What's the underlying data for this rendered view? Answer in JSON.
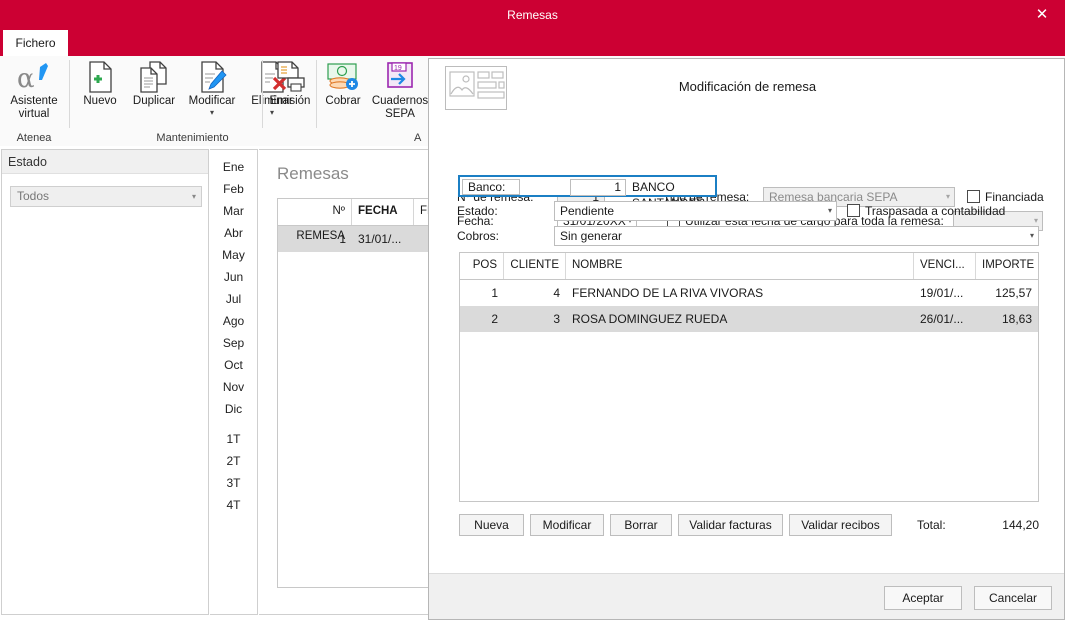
{
  "window": {
    "title": "Remesas",
    "close_label": "✕",
    "accent_color": "#CC0033"
  },
  "ribbon": {
    "tab": "Fichero",
    "groups": [
      {
        "label": "Atenea"
      },
      {
        "label": "Mantenimiento"
      },
      {
        "label": "A"
      }
    ],
    "buttons": {
      "asistente": "Asistente\nvirtual",
      "asistente_line1": "Asistente",
      "asistente_line2": "virtual",
      "nuevo": "Nuevo",
      "duplicar": "Duplicar",
      "modificar": "Modificar",
      "eliminar": "Eliminar",
      "emision": "Emisión",
      "cobrar": "Cobrar",
      "cuadernos_line1": "Cuadernos",
      "cuadernos_line2": "SEPA",
      "caret": "▾"
    }
  },
  "left_panel": {
    "header": "Estado",
    "filter_value": "Todos",
    "arrow": "▾"
  },
  "month_strip": {
    "months": [
      "Ene",
      "Feb",
      "Mar",
      "Abr",
      "May",
      "Jun",
      "Jul",
      "Ago",
      "Sep",
      "Oct",
      "Nov",
      "Dic"
    ],
    "quarters": [
      "1T",
      "2T",
      "3T",
      "4T"
    ]
  },
  "list_panel": {
    "title": "Remesas",
    "columns": [
      "Nº REMESA",
      "FECHA",
      "FEC"
    ],
    "rows": [
      {
        "numero": "1",
        "fecha": "31/01/...",
        "fec": ""
      }
    ],
    "expander": "❯"
  },
  "dialog": {
    "title": "Modificación de remesa",
    "fields": {
      "num_remesa_label": "Nº de remesa:",
      "num_remesa_value": "1",
      "fecha_label": "Fecha:",
      "fecha_value": "31/01/20XX",
      "tipo_label": "Tipo de remesa:",
      "tipo_value": "Remesa bancaria SEPA",
      "financiada_label": "Financiada",
      "usar_fecha_label": "Utilizar esta fecha de cargo para toda la remesa:",
      "usar_fecha_value": "",
      "banco_label": "Banco:",
      "banco_code": "1",
      "banco_name": "BANCO SANTANDER",
      "estado_label": "Estado:",
      "estado_value": "Pendiente",
      "traspasada_label": "Traspasada a contabilidad",
      "cobros_label": "Cobros:",
      "cobros_value": "Sin generar",
      "arrow": "▾"
    },
    "table": {
      "columns": [
        "POS",
        "CLIENTE",
        "NOMBRE",
        "VENCI...",
        "IMPORTE"
      ],
      "rows": [
        {
          "pos": "1",
          "cliente": "4",
          "nombre": "FERNANDO DE LA RIVA VIVORAS",
          "venci": "19/01/...",
          "importe": "125,57",
          "selected": false
        },
        {
          "pos": "2",
          "cliente": "3",
          "nombre": "ROSA DOMINGUEZ RUEDA",
          "venci": "26/01/...",
          "importe": "18,63",
          "selected": true
        }
      ]
    },
    "actions": {
      "nueva": "Nueva",
      "modificar": "Modificar",
      "borrar": "Borrar",
      "validar_facturas": "Validar facturas",
      "validar_recibos": "Validar recibos"
    },
    "total_label": "Total:",
    "total_value": "144,20",
    "footer": {
      "accept": "Aceptar",
      "cancel": "Cancelar"
    }
  }
}
